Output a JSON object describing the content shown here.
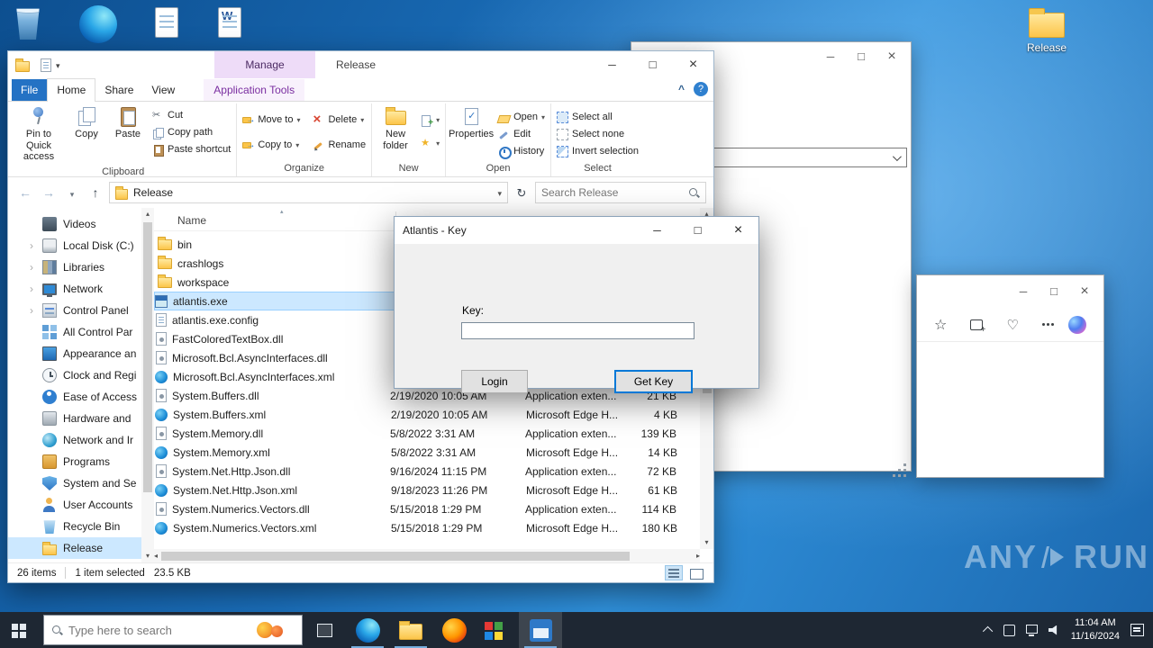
{
  "colors": {
    "accent_blue": "#0078d7",
    "selection_blue": "#cce8ff",
    "contextual_purple": "#7a2ea0"
  },
  "explorer": {
    "window_title": "Release",
    "contextual_group_label": "Manage",
    "help_glyph": "?",
    "tabs": [
      {
        "label": "File"
      },
      {
        "label": "Home"
      },
      {
        "label": "Share"
      },
      {
        "label": "View"
      },
      {
        "label": "Application Tools"
      }
    ],
    "ribbon": {
      "clipboard": {
        "label": "Clipboard",
        "pin_to_quick_access": "Pin to Quick access",
        "copy": "Copy",
        "paste": "Paste",
        "cut": "Cut",
        "copy_path": "Copy path",
        "paste_shortcut": "Paste shortcut"
      },
      "organize": {
        "label": "Organize",
        "move_to": "Move to",
        "copy_to": "Copy to",
        "delete": "Delete",
        "rename": "Rename"
      },
      "new": {
        "label": "New",
        "new_folder": "New folder"
      },
      "open": {
        "label": "Open",
        "properties": "Properties",
        "open": "Open",
        "edit": "Edit",
        "history": "History"
      },
      "select": {
        "label": "Select",
        "select_all": "Select all",
        "select_none": "Select none",
        "invert_selection": "Invert selection"
      }
    },
    "nav": {
      "address": "Release",
      "search_placeholder": "Search Release"
    },
    "sidebar": [
      {
        "label": "Videos",
        "icon": "film",
        "chevron": false
      },
      {
        "label": "Local Disk (C:)",
        "icon": "disk",
        "chevron": true
      },
      {
        "label": "Libraries",
        "icon": "library",
        "chevron": true
      },
      {
        "label": "Network",
        "icon": "monitor",
        "chevron": true
      },
      {
        "label": "Control Panel",
        "icon": "cpanel",
        "chevron": true
      },
      {
        "label": "All Control Par",
        "icon": "grid",
        "chevron": false
      },
      {
        "label": "Appearance an",
        "icon": "display",
        "chevron": false
      },
      {
        "label": "Clock and Regi",
        "icon": "clock",
        "chevron": false
      },
      {
        "label": "Ease of Access",
        "icon": "ease",
        "chevron": false
      },
      {
        "label": "Hardware and",
        "icon": "hardware",
        "chevron": false
      },
      {
        "label": "Network and Ir",
        "icon": "globe",
        "chevron": false
      },
      {
        "label": "Programs",
        "icon": "programs",
        "chevron": false
      },
      {
        "label": "System and Se",
        "icon": "shield",
        "chevron": false
      },
      {
        "label": "User Accounts",
        "icon": "users",
        "chevron": false
      },
      {
        "label": "Recycle Bin",
        "icon": "recycle",
        "chevron": false
      },
      {
        "label": "Release",
        "icon": "folder",
        "chevron": false,
        "selected": true
      }
    ],
    "columns": {
      "name": "Name"
    },
    "files": [
      {
        "name": "bin",
        "icon": "folder",
        "date": "",
        "type": "",
        "size": ""
      },
      {
        "name": "crashlogs",
        "icon": "folder",
        "date": "",
        "type": "",
        "size": ""
      },
      {
        "name": "workspace",
        "icon": "folder",
        "date": "",
        "type": "",
        "size": ""
      },
      {
        "name": "atlantis.exe",
        "icon": "exe",
        "selected": true,
        "date": "",
        "type": "",
        "size": ""
      },
      {
        "name": "atlantis.exe.config",
        "icon": "doc",
        "date": "",
        "type": "",
        "size": ""
      },
      {
        "name": "FastColoredTextBox.dll",
        "icon": "dll",
        "date": "",
        "type": "",
        "size": ""
      },
      {
        "name": "Microsoft.Bcl.AsyncInterfaces.dll",
        "icon": "dll",
        "date": "",
        "type": "",
        "size": ""
      },
      {
        "name": "Microsoft.Bcl.AsyncInterfaces.xml",
        "icon": "xml",
        "date": "",
        "type": "",
        "size": ""
      },
      {
        "name": "System.Buffers.dll",
        "icon": "dll",
        "date": "2/19/2020 10:05 AM",
        "type": "Application exten...",
        "size": "21 KB"
      },
      {
        "name": "System.Buffers.xml",
        "icon": "xml",
        "date": "2/19/2020 10:05 AM",
        "type": "Microsoft Edge H...",
        "size": "4 KB"
      },
      {
        "name": "System.Memory.dll",
        "icon": "dll",
        "date": "5/8/2022 3:31 AM",
        "type": "Application exten...",
        "size": "139 KB"
      },
      {
        "name": "System.Memory.xml",
        "icon": "xml",
        "date": "5/8/2022 3:31 AM",
        "type": "Microsoft Edge H...",
        "size": "14 KB"
      },
      {
        "name": "System.Net.Http.Json.dll",
        "icon": "dll",
        "date": "9/16/2024 11:15 PM",
        "type": "Application exten...",
        "size": "72 KB"
      },
      {
        "name": "System.Net.Http.Json.xml",
        "icon": "xml",
        "date": "9/18/2023 11:26 PM",
        "type": "Microsoft Edge H...",
        "size": "61 KB"
      },
      {
        "name": "System.Numerics.Vectors.dll",
        "icon": "dll",
        "date": "5/15/2018 1:29 PM",
        "type": "Application exten...",
        "size": "114 KB"
      },
      {
        "name": "System.Numerics.Vectors.xml",
        "icon": "xml",
        "date": "5/15/2018 1:29 PM",
        "type": "Microsoft Edge H...",
        "size": "180 KB"
      }
    ],
    "status_bar": {
      "item_count": "26 items",
      "selection": "1 item selected",
      "selection_size": "23.5 KB"
    }
  },
  "key_dialog": {
    "title": "Atlantis - Key",
    "key_label": "Key:",
    "key_value": "",
    "login_button": "Login",
    "get_key_button": "Get Key"
  },
  "desktop": {
    "release_shortcut_label": "Release"
  },
  "taskbar": {
    "search_placeholder": "Type here to search",
    "clock_time": "11:04 AM",
    "clock_date": "11/16/2024"
  },
  "watermark": {
    "left": "ANY",
    "right": "RUN"
  }
}
